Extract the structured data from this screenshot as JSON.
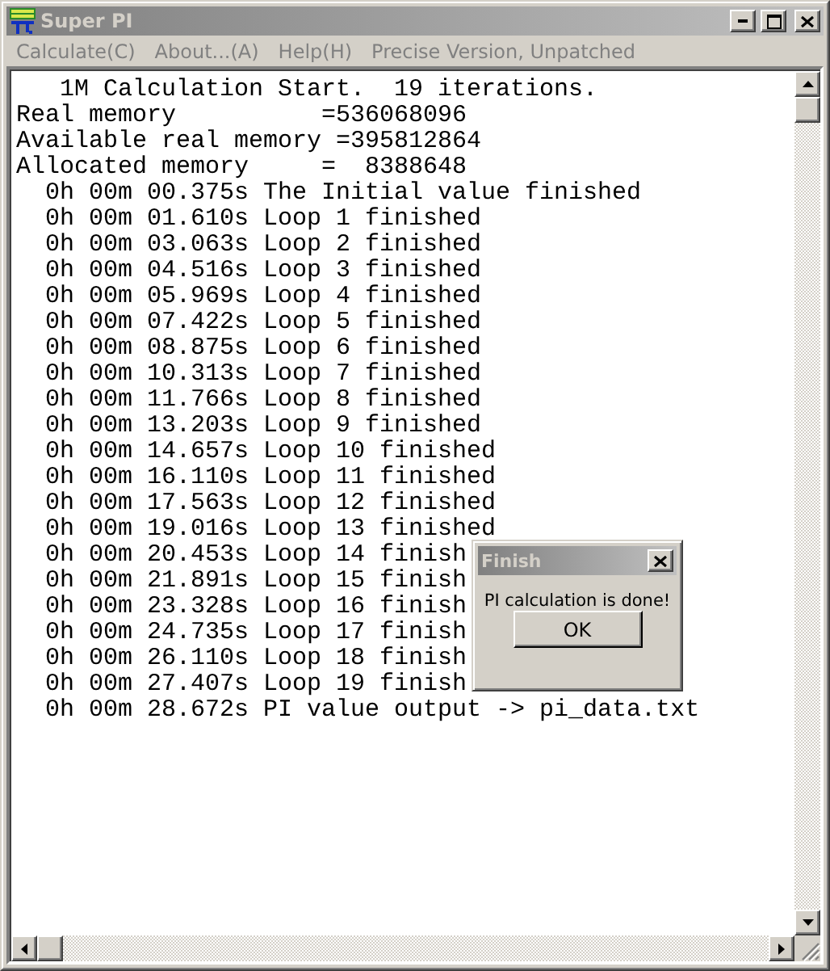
{
  "window": {
    "title": "Super PI"
  },
  "menu": [
    {
      "label": "Calculate(C)",
      "disabled": true
    },
    {
      "label": "About...(A)",
      "disabled": true
    },
    {
      "label": "Help(H)",
      "disabled": true
    },
    {
      "label": "Precise Version, Unpatched",
      "disabled": true
    }
  ],
  "console": [
    {
      "kind": "header",
      "text": "1M Calculation Start.  19 iterations."
    },
    {
      "kind": "memory",
      "text": "Real memory          =536068096"
    },
    {
      "kind": "memory",
      "text": "Available real memory =395812864"
    },
    {
      "kind": "memory",
      "text": "Allocated memory     =  8388648"
    },
    {
      "kind": "timing",
      "text": "0h 00m 00.375s The Initial value finished"
    },
    {
      "kind": "timing",
      "text": "0h 00m 01.610s Loop 1 finished"
    },
    {
      "kind": "timing",
      "text": "0h 00m 03.063s Loop 2 finished"
    },
    {
      "kind": "timing",
      "text": "0h 00m 04.516s Loop 3 finished"
    },
    {
      "kind": "timing",
      "text": "0h 00m 05.969s Loop 4 finished"
    },
    {
      "kind": "timing",
      "text": "0h 00m 07.422s Loop 5 finished"
    },
    {
      "kind": "timing",
      "text": "0h 00m 08.875s Loop 6 finished"
    },
    {
      "kind": "timing",
      "text": "0h 00m 10.313s Loop 7 finished"
    },
    {
      "kind": "timing",
      "text": "0h 00m 11.766s Loop 8 finished"
    },
    {
      "kind": "timing",
      "text": "0h 00m 13.203s Loop 9 finished"
    },
    {
      "kind": "timing",
      "text": "0h 00m 14.657s Loop 10 finished"
    },
    {
      "kind": "timing",
      "text": "0h 00m 16.110s Loop 11 finished"
    },
    {
      "kind": "timing",
      "text": "0h 00m 17.563s Loop 12 finished"
    },
    {
      "kind": "timing",
      "text": "0h 00m 19.016s Loop 13 finished"
    },
    {
      "kind": "timing",
      "text": "0h 00m 20.453s Loop 14 finish"
    },
    {
      "kind": "timing",
      "text": "0h 00m 21.891s Loop 15 finish"
    },
    {
      "kind": "timing",
      "text": "0h 00m 23.328s Loop 16 finish"
    },
    {
      "kind": "timing",
      "text": "0h 00m 24.735s Loop 17 finish"
    },
    {
      "kind": "timing",
      "text": "0h 00m 26.110s Loop 18 finish"
    },
    {
      "kind": "timing",
      "text": "0h 00m 27.407s Loop 19 finish"
    },
    {
      "kind": "timing",
      "text": "0h 00m 28.672s PI value output -> pi_data.txt"
    }
  ],
  "dialog": {
    "title": "Finish",
    "message": "PI calculation is done!",
    "button": "OK"
  }
}
